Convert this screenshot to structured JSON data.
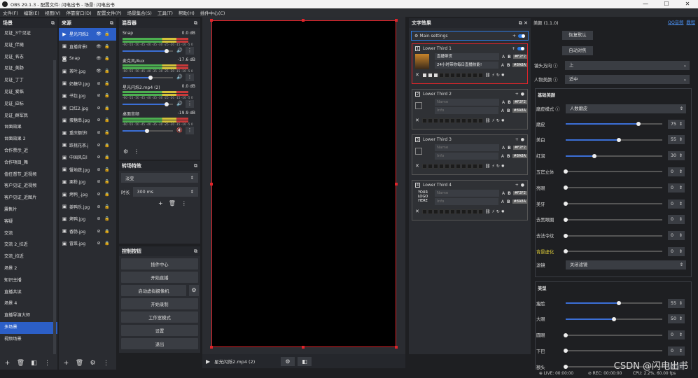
{
  "window": {
    "title": "OBS 29.1.3 - 配置文件: 闪电出书 - 场景: 闪电出书",
    "min": "—",
    "max": "☐",
    "close": "✕"
  },
  "menu": [
    "文件(F)",
    "编辑(E)",
    "视图(V)",
    "停靠窗口(D)",
    "配置文件(P)",
    "场景集合(S)",
    "工具(T)",
    "帮助(H)",
    "插件中心(C)"
  ],
  "scenes": {
    "title": "场景",
    "items": [
      "见证_3个见证",
      "见证_伴随",
      "见证_名志",
      "见证_美肠",
      "见证_丁丁",
      "见证_爱临",
      "见证_应标",
      "见证_群军民",
      "台面效果",
      "台面效果 2",
      "合作票示_近",
      "合作项目_舞",
      "值任督节_近视频",
      "客户见证_近视频",
      "客户见证_近图片",
      "震售片",
      "客疑",
      "交流",
      "交流 2_拉近",
      "交流_拉近",
      "场景 2",
      "知识主播",
      "直播共读",
      "场景 4",
      "直播导演大师",
      "多场景",
      "视频场景"
    ],
    "selected_index": 25
  },
  "sources": {
    "title": "来源",
    "items": [
      {
        "name": "星光闪烁2",
        "icon": "▶",
        "sel": true
      },
      {
        "name": "直播背景l",
        "icon": "▣",
        "sel": false
      },
      {
        "name": "Snap",
        "icon": "◙",
        "sel": false
      },
      {
        "name": "茶叶.jpg",
        "icon": "▣",
        "sel": false
      },
      {
        "name": "奶糖华.jpg",
        "icon": "▣",
        "sel": false
      },
      {
        "name": "书包.jpg",
        "icon": "▣",
        "sel": false
      },
      {
        "name": "口红2.jpg",
        "icon": "▣",
        "sel": false
      },
      {
        "name": "蛋糖串.jpg",
        "icon": "▣",
        "sel": false
      },
      {
        "name": "重庆额饼l",
        "icon": "▣",
        "sel": false
      },
      {
        "name": "跌桃花茶.j",
        "icon": "▣",
        "sel": false
      },
      {
        "name": "中国风白l",
        "icon": "▣",
        "sel": false
      },
      {
        "name": "蟹地蔬.jpg",
        "icon": "▣",
        "sel": false
      },
      {
        "name": "栗粉.jpg",
        "icon": "▣",
        "sel": false
      },
      {
        "name": "烤鸭_.jpg",
        "icon": "▣",
        "sel": false
      },
      {
        "name": "姜鸭乐.jpg",
        "icon": "▣",
        "sel": false
      },
      {
        "name": "烤鸭.jpg",
        "icon": "▣",
        "sel": false
      },
      {
        "name": "香肠.jpg",
        "icon": "▣",
        "sel": false
      },
      {
        "name": "冒菜.jpg",
        "icon": "▣",
        "sel": false
      }
    ]
  },
  "mixer": {
    "title": "混音器",
    "ticks": "-60 -55 -50 -45 -40 -35 -30 -25 -20 -15 -10 -5 0",
    "items": [
      {
        "name": "Snap",
        "db": "0.0 dB",
        "level": 0.88,
        "muted": false
      },
      {
        "name": "麦克风/Aux",
        "db": "-17.6 dB",
        "level": 0.55,
        "muted": false
      },
      {
        "name": "星光闪烁2.mp4 (2)",
        "db": "0.0 dB",
        "level": 0.88,
        "muted": false
      },
      {
        "name": "桌面音频",
        "db": "-19.9 dB",
        "level": 0.48,
        "muted": true
      }
    ]
  },
  "transitions": {
    "title": "转场特效",
    "type": "淡变",
    "duration_label": "时长",
    "duration": "300 ms"
  },
  "controls": {
    "title": "控制按钮",
    "buttons": [
      "插件中心",
      "开始直播",
      "启动虚拟摄像机",
      "开始录制",
      "工作室模式",
      "设置",
      "退出"
    ]
  },
  "preview": {
    "media_name": "星光闪烁2.mp4 (2)"
  },
  "text_effects": {
    "title": "文字效果",
    "main_settings": "Main settings",
    "items": [
      {
        "num": "1",
        "name": "Lower Third 1",
        "line1": "直播带货",
        "line2": "24小时带你每日直播技能!",
        "c1": "#F2F2",
        "c2": "#8A8A",
        "placeholder1": "Name",
        "placeholder2": "Info",
        "filled": true
      },
      {
        "num": "2",
        "name": "Lower Third 2",
        "line1": "",
        "line2": "",
        "c1": "#F2F2",
        "c2": "#8A8A",
        "placeholder1": "Name",
        "placeholder2": "Info",
        "filled": false
      },
      {
        "num": "3",
        "name": "Lower Third 3",
        "line1": "",
        "line2": "",
        "c1": "#F2F2",
        "c2": "#8A8A",
        "placeholder1": "Name",
        "placeholder2": "Info",
        "filled": false
      },
      {
        "num": "4",
        "name": "Lower Third 4",
        "line1": "",
        "line2": "",
        "c1": "#F2F2",
        "c2": "#8A8A",
        "placeholder1": "Name",
        "placeholder2": "Info",
        "filled": false,
        "logo": "YOUR LOGO HERE"
      }
    ]
  },
  "beauty": {
    "title": "美颜 (1.1.0)",
    "links": [
      "QQ音频",
      "教程"
    ],
    "restore": "恢复默认",
    "auto": "自动对焦",
    "direction_label": "镜头方向",
    "direction": "上",
    "mode_label": "人物美颜",
    "mode": "适中",
    "basic_title": "基础美颜",
    "skin_label": "磨皮模式",
    "skin": "人数磨皮",
    "sliders": [
      {
        "label": "磨皮",
        "value": 75
      },
      {
        "label": "美白",
        "value": 55
      },
      {
        "label": "红润",
        "value": 30
      },
      {
        "label": "五官立体",
        "value": 0
      },
      {
        "label": "亮眼",
        "value": 0
      },
      {
        "label": "美牙",
        "value": 0
      },
      {
        "label": "去黑眼圈",
        "value": 0
      },
      {
        "label": "去法令纹",
        "value": 0
      },
      {
        "label": "背景虚化",
        "value": 0
      }
    ],
    "filter_label": "滤镜",
    "filter": "关闭滤镜",
    "shape_title": "美型",
    "shape_sliders": [
      {
        "label": "瘦脸",
        "value": 55
      },
      {
        "label": "大眼",
        "value": 50
      },
      {
        "label": "圆眼",
        "value": 0
      },
      {
        "label": "下巴",
        "value": 0
      },
      {
        "label": "额头",
        "value": 0
      }
    ]
  },
  "status": {
    "live": "LIVE: 00:00:00",
    "rec": "REC: 00:00:00",
    "cpu": "CPU: 2.2%, 60.00 fps"
  },
  "watermark": "CSDN @闪电出书"
}
